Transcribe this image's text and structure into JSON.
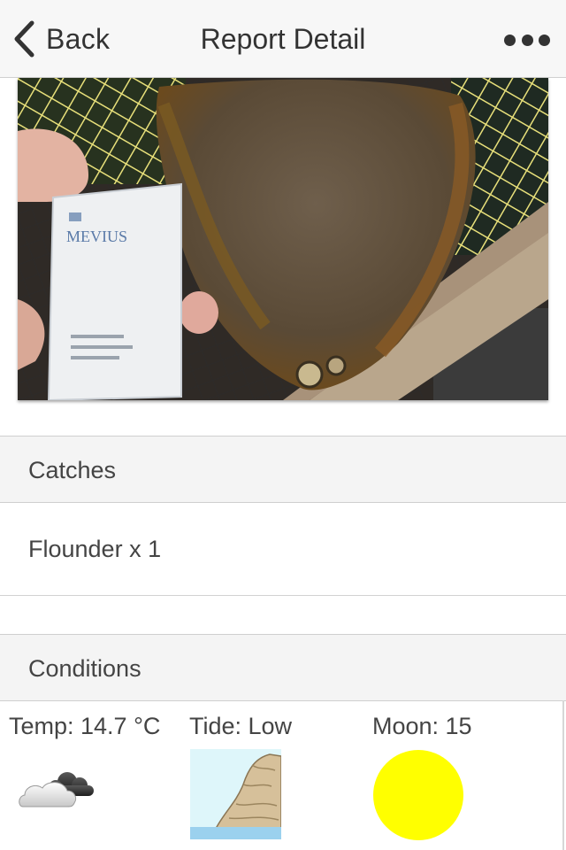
{
  "nav": {
    "back_label": "Back",
    "title": "Report Detail",
    "back_icon": "chevron-left-icon",
    "more_icon": "more-horizontal-icon"
  },
  "photo": {
    "subject": "catch-photo"
  },
  "catches": {
    "header": "Catches",
    "items": [
      {
        "text": "Flounder x 1"
      }
    ]
  },
  "conditions": {
    "header": "Conditions",
    "temp_label": "Temp: 14.7 °C",
    "tide_label": "Tide: Low",
    "moon_label": "Moon: 15",
    "weather_icon": "cloudy-icon",
    "tide_icon": "low-tide-icon",
    "moon_icon": "full-moon-icon",
    "moon_color": "#ffff00"
  },
  "colors": {
    "navbar_bg": "#f7f7f7",
    "section_bg": "#f4f4f4",
    "text": "#444444"
  }
}
